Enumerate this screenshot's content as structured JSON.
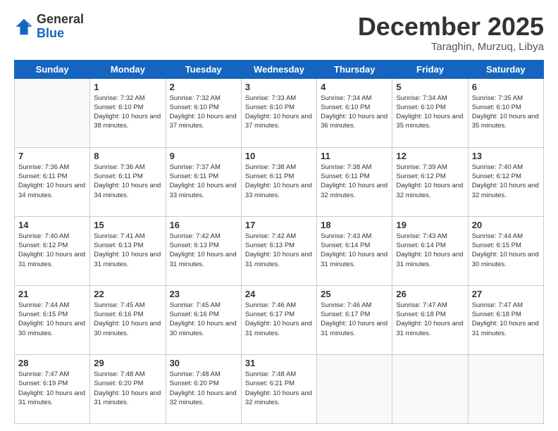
{
  "logo": {
    "general": "General",
    "blue": "Blue"
  },
  "header": {
    "month": "December 2025",
    "location": "Taraghin, Murzuq, Libya"
  },
  "days_of_week": [
    "Sunday",
    "Monday",
    "Tuesday",
    "Wednesday",
    "Thursday",
    "Friday",
    "Saturday"
  ],
  "weeks": [
    [
      {
        "day": "",
        "info": ""
      },
      {
        "day": "1",
        "info": "Sunrise: 7:32 AM\nSunset: 6:10 PM\nDaylight: 10 hours and 38 minutes."
      },
      {
        "day": "2",
        "info": "Sunrise: 7:32 AM\nSunset: 6:10 PM\nDaylight: 10 hours and 37 minutes."
      },
      {
        "day": "3",
        "info": "Sunrise: 7:33 AM\nSunset: 6:10 PM\nDaylight: 10 hours and 37 minutes."
      },
      {
        "day": "4",
        "info": "Sunrise: 7:34 AM\nSunset: 6:10 PM\nDaylight: 10 hours and 36 minutes."
      },
      {
        "day": "5",
        "info": "Sunrise: 7:34 AM\nSunset: 6:10 PM\nDaylight: 10 hours and 35 minutes."
      },
      {
        "day": "6",
        "info": "Sunrise: 7:35 AM\nSunset: 6:10 PM\nDaylight: 10 hours and 35 minutes."
      }
    ],
    [
      {
        "day": "7",
        "info": "Sunrise: 7:36 AM\nSunset: 6:11 PM\nDaylight: 10 hours and 34 minutes."
      },
      {
        "day": "8",
        "info": "Sunrise: 7:36 AM\nSunset: 6:11 PM\nDaylight: 10 hours and 34 minutes."
      },
      {
        "day": "9",
        "info": "Sunrise: 7:37 AM\nSunset: 6:11 PM\nDaylight: 10 hours and 33 minutes."
      },
      {
        "day": "10",
        "info": "Sunrise: 7:38 AM\nSunset: 6:11 PM\nDaylight: 10 hours and 33 minutes."
      },
      {
        "day": "11",
        "info": "Sunrise: 7:38 AM\nSunset: 6:11 PM\nDaylight: 10 hours and 32 minutes."
      },
      {
        "day": "12",
        "info": "Sunrise: 7:39 AM\nSunset: 6:12 PM\nDaylight: 10 hours and 32 minutes."
      },
      {
        "day": "13",
        "info": "Sunrise: 7:40 AM\nSunset: 6:12 PM\nDaylight: 10 hours and 32 minutes."
      }
    ],
    [
      {
        "day": "14",
        "info": "Sunrise: 7:40 AM\nSunset: 6:12 PM\nDaylight: 10 hours and 31 minutes."
      },
      {
        "day": "15",
        "info": "Sunrise: 7:41 AM\nSunset: 6:13 PM\nDaylight: 10 hours and 31 minutes."
      },
      {
        "day": "16",
        "info": "Sunrise: 7:42 AM\nSunset: 6:13 PM\nDaylight: 10 hours and 31 minutes."
      },
      {
        "day": "17",
        "info": "Sunrise: 7:42 AM\nSunset: 6:13 PM\nDaylight: 10 hours and 31 minutes."
      },
      {
        "day": "18",
        "info": "Sunrise: 7:43 AM\nSunset: 6:14 PM\nDaylight: 10 hours and 31 minutes."
      },
      {
        "day": "19",
        "info": "Sunrise: 7:43 AM\nSunset: 6:14 PM\nDaylight: 10 hours and 31 minutes."
      },
      {
        "day": "20",
        "info": "Sunrise: 7:44 AM\nSunset: 6:15 PM\nDaylight: 10 hours and 30 minutes."
      }
    ],
    [
      {
        "day": "21",
        "info": "Sunrise: 7:44 AM\nSunset: 6:15 PM\nDaylight: 10 hours and 30 minutes."
      },
      {
        "day": "22",
        "info": "Sunrise: 7:45 AM\nSunset: 6:16 PM\nDaylight: 10 hours and 30 minutes."
      },
      {
        "day": "23",
        "info": "Sunrise: 7:45 AM\nSunset: 6:16 PM\nDaylight: 10 hours and 30 minutes."
      },
      {
        "day": "24",
        "info": "Sunrise: 7:46 AM\nSunset: 6:17 PM\nDaylight: 10 hours and 31 minutes."
      },
      {
        "day": "25",
        "info": "Sunrise: 7:46 AM\nSunset: 6:17 PM\nDaylight: 10 hours and 31 minutes."
      },
      {
        "day": "26",
        "info": "Sunrise: 7:47 AM\nSunset: 6:18 PM\nDaylight: 10 hours and 31 minutes."
      },
      {
        "day": "27",
        "info": "Sunrise: 7:47 AM\nSunset: 6:18 PM\nDaylight: 10 hours and 31 minutes."
      }
    ],
    [
      {
        "day": "28",
        "info": "Sunrise: 7:47 AM\nSunset: 6:19 PM\nDaylight: 10 hours and 31 minutes."
      },
      {
        "day": "29",
        "info": "Sunrise: 7:48 AM\nSunset: 6:20 PM\nDaylight: 10 hours and 31 minutes."
      },
      {
        "day": "30",
        "info": "Sunrise: 7:48 AM\nSunset: 6:20 PM\nDaylight: 10 hours and 32 minutes."
      },
      {
        "day": "31",
        "info": "Sunrise: 7:48 AM\nSunset: 6:21 PM\nDaylight: 10 hours and 32 minutes."
      },
      {
        "day": "",
        "info": ""
      },
      {
        "day": "",
        "info": ""
      },
      {
        "day": "",
        "info": ""
      }
    ]
  ]
}
